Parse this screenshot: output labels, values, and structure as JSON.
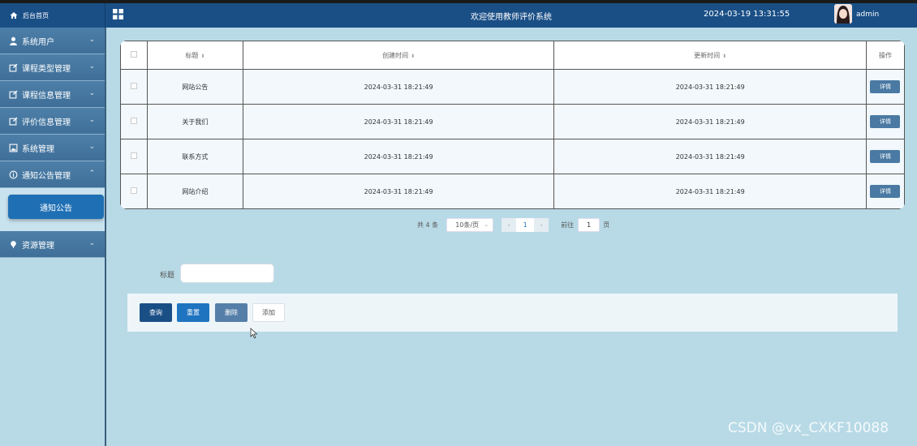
{
  "header": {
    "home_label": "后台首页",
    "title": "欢迎使用教师评价系统",
    "datetime": "2024-03-19 13:31:55",
    "username": "admin"
  },
  "sidebar": {
    "items": [
      {
        "label": "系统用户",
        "icon": "user-icon"
      },
      {
        "label": "课程类型管理",
        "icon": "edit-icon"
      },
      {
        "label": "课程信息管理",
        "icon": "edit-icon"
      },
      {
        "label": "评价信息管理",
        "icon": "edit-icon"
      },
      {
        "label": "系统管理",
        "icon": "image-icon"
      },
      {
        "label": "通知公告管理",
        "icon": "info-icon",
        "expanded": true
      },
      {
        "label": "资源管理",
        "icon": "pin-icon"
      }
    ],
    "active_sub": "通知公告"
  },
  "table": {
    "headers": [
      "标题",
      "创建时间",
      "更新时间",
      "操作"
    ],
    "rows": [
      {
        "title": "网站公告",
        "created": "2024-03-31 18:21:49",
        "updated": "2024-03-31 18:21:49",
        "action": "详情"
      },
      {
        "title": "关于我们",
        "created": "2024-03-31 18:21:49",
        "updated": "2024-03-31 18:21:49",
        "action": "详情"
      },
      {
        "title": "联系方式",
        "created": "2024-03-31 18:21:49",
        "updated": "2024-03-31 18:21:49",
        "action": "详情"
      },
      {
        "title": "网站介绍",
        "created": "2024-03-31 18:21:49",
        "updated": "2024-03-31 18:21:49",
        "action": "详情"
      }
    ]
  },
  "pagination": {
    "total": "共 4 条",
    "page_size": "10条/页",
    "current_page": "1",
    "goto_label": "前往",
    "goto_value": "1",
    "page_unit": "页"
  },
  "search": {
    "label": "标题",
    "value": ""
  },
  "actions": {
    "query": "查询",
    "reset": "重置",
    "delete": "删除",
    "add": "添加"
  },
  "watermark": "CSDN @vx_CXKF10088",
  "colors": {
    "header_bg": "#1a4f86",
    "sidebar_item": "#4a7aa3",
    "active_sub": "#1f6fb4",
    "page_bg": "#b8dae6"
  }
}
